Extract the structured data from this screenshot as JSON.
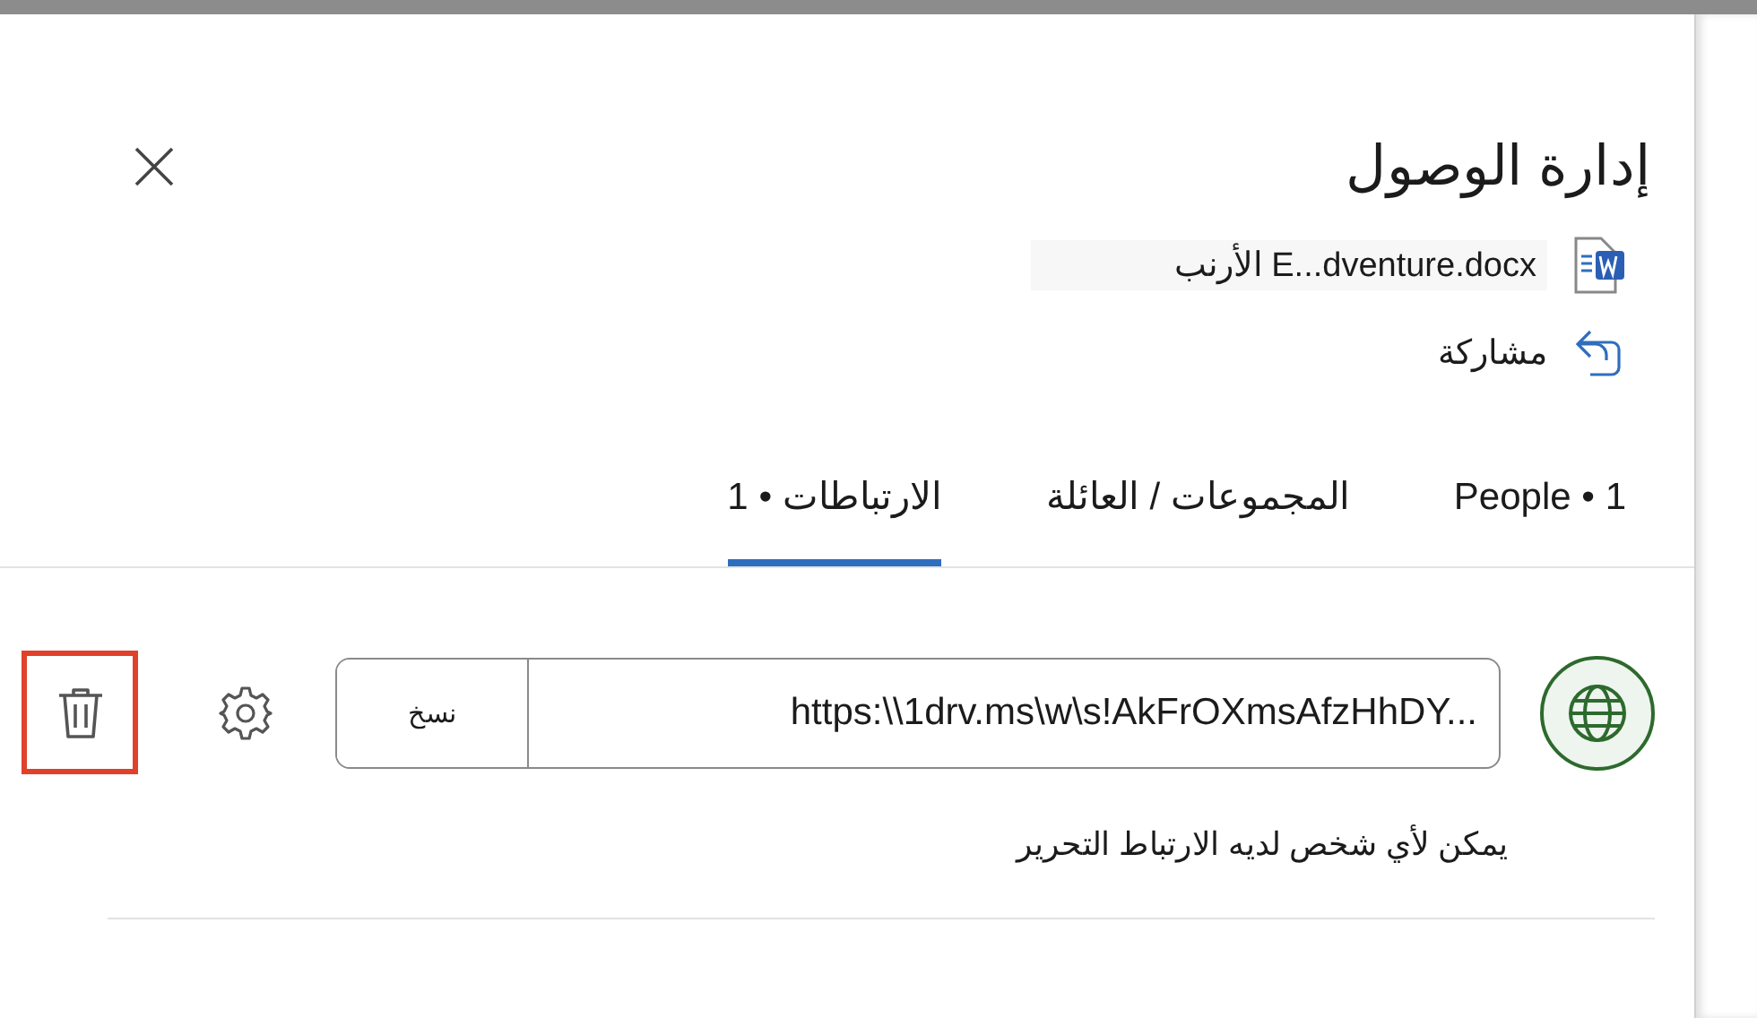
{
  "dialog": {
    "title": "إدارة الوصول"
  },
  "file": {
    "name": "E...dventure.docx الأرنب"
  },
  "share": {
    "label": "مشاركة"
  },
  "tabs": [
    {
      "label": "People • 1",
      "selected": false
    },
    {
      "label": "المجموعات / العائلة",
      "selected": false
    },
    {
      "label": "الارتباطات • 1",
      "selected": true
    }
  ],
  "link": {
    "url": "https:\\\\1drv.ms\\w\\s!AkFrOXmsAfzHhDY...",
    "copy_label": "نسخ",
    "description": "يمكن لأي شخص لديه الارتباط التحرير",
    "delete_highlighted": true
  }
}
